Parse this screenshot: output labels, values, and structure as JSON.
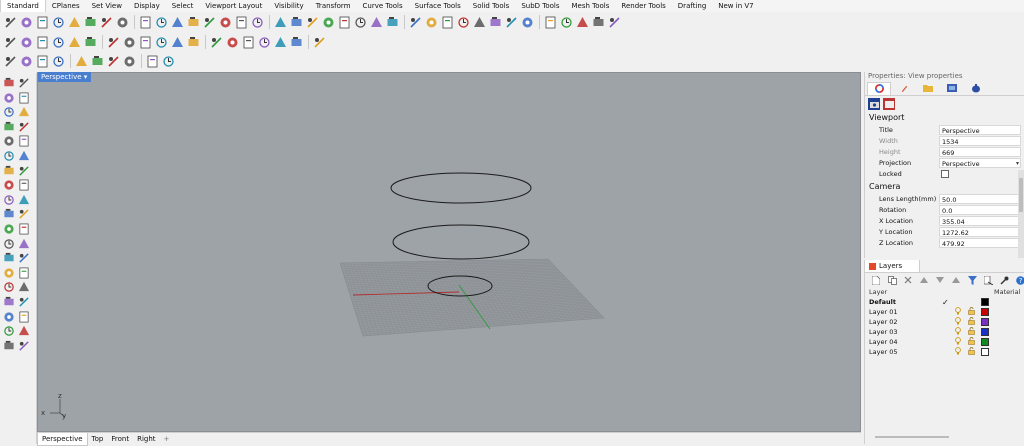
{
  "tabs": [
    "Standard",
    "CPlanes",
    "Set View",
    "Display",
    "Select",
    "Viewport Layout",
    "Visibility",
    "Transform",
    "Curve Tools",
    "Surface Tools",
    "Solid Tools",
    "SubD Tools",
    "Mesh Tools",
    "Render Tools",
    "Drafting",
    "New in V7"
  ],
  "active_tab_index": 0,
  "toolbar_rows": {
    "row1_icons": [
      "new-icon",
      "open-icon",
      "save-icon",
      "print-icon",
      "import-icon",
      "cut-icon",
      "copy-icon",
      "paste-icon",
      "undo-icon",
      "pan-icon",
      "rotate-view-icon",
      "zoom-icon",
      "zoom-window-icon",
      "zoom-extents-icon",
      "zoom-selected-icon",
      "undo-view-icon",
      "four-views-icon",
      "cplane-icon",
      "set-cplane-icon",
      "named-views-icon",
      "select-icon",
      "lock-icon",
      "hide-icon",
      "point-icon",
      "curve-icon",
      "surface-icon",
      "solid-icon",
      "render-icon",
      "material-icon",
      "environment-icon",
      "sun-icon",
      "wireframe-icon",
      "shaded-icon",
      "layer-icon",
      "properties-icon",
      "options-icon",
      "help-icon"
    ],
    "row2_icons": [
      "show-all-icon",
      "hide-objects-icon",
      "show-selected-icon",
      "light-on-icon",
      "light-off-icon",
      "select-lights-icon",
      "lock-doc-icon",
      "unlock-icon",
      "lock-object-icon",
      "unlock-object-icon",
      "select-locked-icon",
      "isolate-icon",
      "unisolate-icon",
      "hide-points-icon",
      "show-points-icon",
      "layer-state-icon",
      "layer-on-icon",
      "layer-off-icon",
      "layer-lock-icon"
    ],
    "row3_icons": [
      "cancel-icon",
      "viewport-icon",
      "maximize-icon",
      "cplane-grid-icon",
      "filter-icon",
      "dimension-icon",
      "snap-icon",
      "sun-light-icon",
      "osnap-icon",
      "gumball-icon"
    ]
  },
  "viewport": {
    "title": "Perspective",
    "bottom_tabs": [
      "Perspective",
      "Top",
      "Front",
      "Right"
    ],
    "add_tab_symbol": "+",
    "axis_labels": {
      "x": "x",
      "y": "y",
      "z": "z"
    },
    "colors": {
      "background": "#9ea3a8",
      "grid": "#8f9296",
      "x_axis": "#b03030",
      "y_axis": "#2f9a3a",
      "curve": "#1a1a1a"
    }
  },
  "properties": {
    "header": "Properties: View properties",
    "tab_icons": [
      "color-wheel-icon",
      "pencil-icon",
      "folder-icon",
      "image-icon",
      "teapot-icon"
    ],
    "section_viewport": "Viewport",
    "section_camera": "Camera",
    "fields": [
      {
        "label": "Title",
        "value": "Perspective",
        "dim": false
      },
      {
        "label": "Width",
        "value": "1534",
        "dim": true
      },
      {
        "label": "Height",
        "value": "669",
        "dim": true
      },
      {
        "label": "Projection",
        "value": "Perspective",
        "dim": false,
        "dropdown": true
      },
      {
        "label": "Locked",
        "value": "",
        "dim": false,
        "checkbox": true
      }
    ],
    "camera_fields": [
      {
        "label": "Lens Length(mm)",
        "value": "50.0"
      },
      {
        "label": "Rotation",
        "value": "0.0"
      },
      {
        "label": "X Location",
        "value": "355.04"
      },
      {
        "label": "Y Location",
        "value": "1272.62"
      },
      {
        "label": "Z Location",
        "value": "479.92"
      }
    ]
  },
  "layers": {
    "tab_label": "Layers",
    "col_layer": "Layer",
    "col_material": "Material",
    "rows": [
      {
        "name": "Default",
        "current": true,
        "check": "✓",
        "color": "#000000",
        "bold": true
      },
      {
        "name": "Layer 01",
        "current": false,
        "check": "",
        "color": "#cc0000",
        "bold": false
      },
      {
        "name": "Layer 02",
        "current": false,
        "check": "",
        "color": "#7a2fc0",
        "bold": false
      },
      {
        "name": "Layer 03",
        "current": false,
        "check": "",
        "color": "#1a2ecc",
        "bold": false
      },
      {
        "name": "Layer 04",
        "current": false,
        "check": "",
        "color": "#118a1f",
        "bold": false
      },
      {
        "name": "Layer 05",
        "current": false,
        "check": "",
        "color": "#ffffff",
        "bold": false
      }
    ]
  }
}
